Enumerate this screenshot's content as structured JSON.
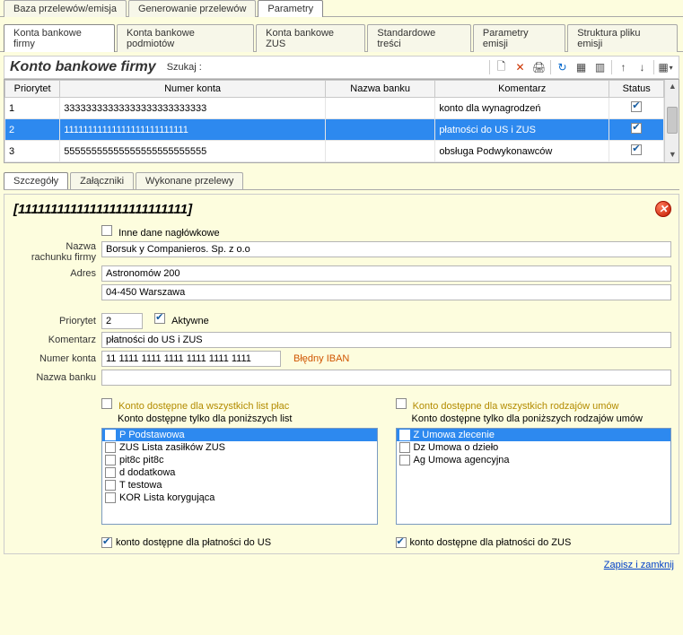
{
  "mainTabs": [
    "Baza przelewów/emisja",
    "Generowanie przelewów",
    "Parametry"
  ],
  "mainTabActive": 2,
  "subTabs": [
    "Konta bankowe firmy",
    "Konta bankowe podmiotów",
    "Konta bankowe ZUS",
    "Standardowe treści",
    "Parametry emisji",
    "Struktura pliku emisji"
  ],
  "subTabActive": 0,
  "titleBar": {
    "title": "Konto bankowe firmy",
    "searchLabel": "Szukaj  :"
  },
  "toolbarIcons": {
    "new": "🗋",
    "del": "✕",
    "print": "🖨",
    "refresh": "↻",
    "cols": "▦",
    "layout": "▥",
    "up": "↑",
    "down": "↓",
    "grid": "▦"
  },
  "grid": {
    "headers": [
      "Priorytet",
      "Numer konta",
      "Nazwa banku",
      "Komentarz",
      "Status"
    ],
    "colWidths": [
      "60px",
      "290px",
      "120px",
      "190px",
      "60px"
    ],
    "rows": [
      {
        "cells": [
          "1",
          "33333333333333333333333333",
          "",
          "konto dla wynagrodzeń"
        ],
        "checked": true,
        "selected": false
      },
      {
        "cells": [
          "2",
          "11111111111111111111111111",
          "",
          "płatności do US i ZUS"
        ],
        "checked": true,
        "selected": true
      },
      {
        "cells": [
          "3",
          "55555555555555555555555555",
          "",
          "obsługa Podwykonawców"
        ],
        "checked": true,
        "selected": false
      }
    ]
  },
  "detailTabs": [
    "Szczegóły",
    "Załączniki",
    "Wykonane przelewy"
  ],
  "detailTabActive": 0,
  "detail": {
    "headerId": "[11111111111111111111111111]",
    "headerExtraCb": {
      "checked": false,
      "label": "Inne dane nagłówkowe"
    },
    "nameLbl1": "Nazwa",
    "nameLbl2": "rachunku firmy",
    "nameVal": "Borsuk y Companieros. Sp. z o.o",
    "addrLbl": "Adres",
    "addr1": "Astronomów 200",
    "addr2": "04-450 Warszawa",
    "prioLbl": "Priorytet",
    "prioVal": "2",
    "activeLbl": "Aktywne",
    "activeChecked": true,
    "commentLbl": "Komentarz",
    "commentVal": "płatności do US i ZUS",
    "acctLbl": "Numer konta",
    "acctVal": "11 1111 1111 1111 1111 1111 1111",
    "acctErr": "Błędny IBAN",
    "bankLbl": "Nazwa banku",
    "bankVal": ""
  },
  "lists": {
    "left": {
      "t1": "Konto dostępne dla wszystkich list płac",
      "t1checked": false,
      "t2": "Konto dostępne tylko dla poniższych list",
      "items": [
        {
          "label": "P Podstawowa",
          "sel": true
        },
        {
          "label": "ZUS Lista zasiłków ZUS",
          "sel": false
        },
        {
          "label": "pit8c pit8c",
          "sel": false
        },
        {
          "label": "d dodatkowa",
          "sel": false
        },
        {
          "label": "T testowa",
          "sel": false
        },
        {
          "label": "KOR Lista korygująca",
          "sel": false
        }
      ]
    },
    "right": {
      "t1": "Konto dostępne dla wszystkich rodzajów umów",
      "t1checked": false,
      "t2": "Konto dostępne tylko dla poniższych rodzajów umów",
      "items": [
        {
          "label": "Z Umowa zlecenie",
          "sel": true
        },
        {
          "label": "Dz Umowa o dzieło",
          "sel": false
        },
        {
          "label": "Ag Umowa agencyjna",
          "sel": false
        }
      ]
    }
  },
  "bottom": {
    "leftLabel": "konto dostępne dla płatności do US",
    "leftChecked": true,
    "rightLabel": "konto dostępne dla płatności do ZUS",
    "rightChecked": true
  },
  "saveLink": "Zapisz i zamknij"
}
